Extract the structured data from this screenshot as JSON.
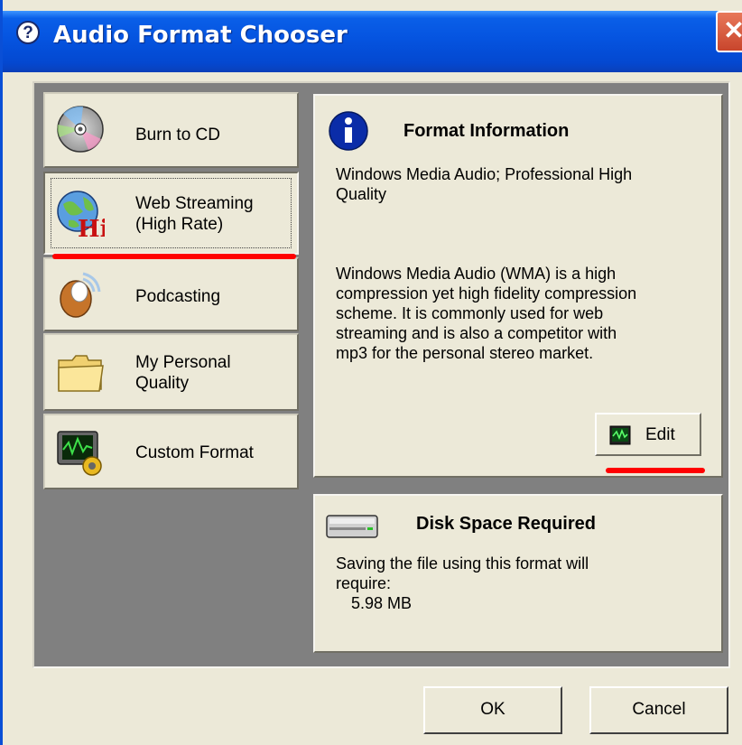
{
  "window": {
    "title": "Audio Format Chooser",
    "title_icon": "help-question-icon",
    "close_label": "✕"
  },
  "formats": [
    {
      "label": "Burn to CD",
      "icon": "cd-disc-icon"
    },
    {
      "label": "Web Streaming\n(High Rate)",
      "icon": "globe-hi-icon",
      "selected": true
    },
    {
      "label": "Podcasting",
      "icon": "podcast-icon"
    },
    {
      "label": "My Personal\nQuality",
      "icon": "folder-icon"
    },
    {
      "label": "Custom Format",
      "icon": "custom-format-icon"
    }
  ],
  "info": {
    "heading": "Format Information",
    "icon": "info-icon",
    "format_name": "Windows Media Audio; Professional High\nQuality",
    "description": "Windows Media Audio (WMA) is a high\ncompression yet high fidelity compression\nscheme.  It is commonly used for web\nstreaming and is also a competitor with\nmp3 for the personal stereo market.",
    "edit_label": "Edit",
    "edit_icon": "waveform-monitor-icon"
  },
  "disk": {
    "heading": "Disk Space Required",
    "icon": "hard-drive-icon",
    "text": "Saving the file using this format will\nrequire:",
    "size": "5.98 MB"
  },
  "buttons": {
    "ok": "OK",
    "cancel": "Cancel"
  },
  "colors": {
    "titlebar": "#0554E0",
    "face": "#ECE9D8",
    "panel_bg": "#808080",
    "annotation": "#FF0000"
  }
}
